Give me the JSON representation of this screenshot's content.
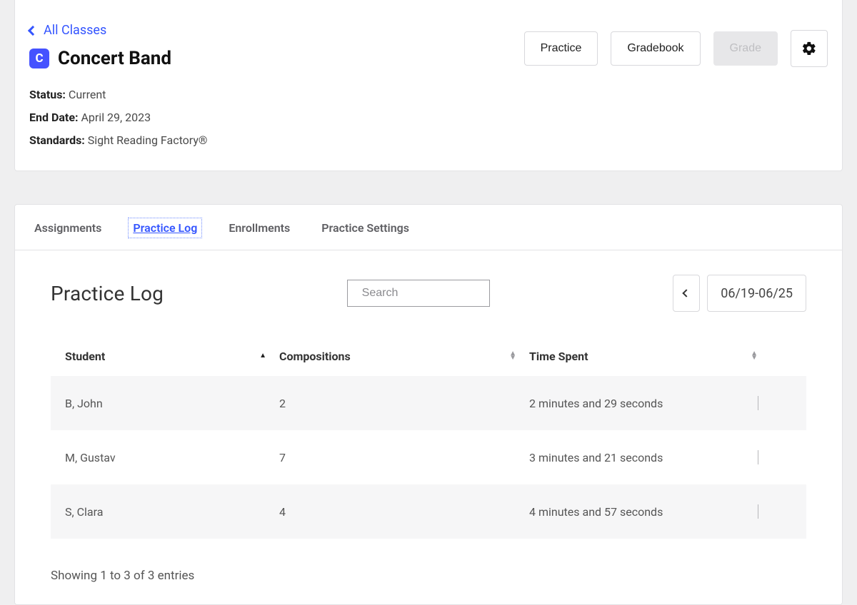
{
  "breadcrumb": {
    "back_label": "All Classes"
  },
  "class": {
    "badge_letter": "C",
    "title": "Concert Band",
    "status_label": "Status:",
    "status_value": "Current",
    "end_label": "End Date:",
    "end_value": "April 29, 2023",
    "standards_label": "Standards:",
    "standards_value": "Sight Reading Factory®"
  },
  "header_actions": {
    "practice": "Practice",
    "gradebook": "Gradebook",
    "grade": "Grade"
  },
  "tabs": {
    "assignments": "Assignments",
    "practice_log": "Practice Log",
    "enrollments": "Enrollments",
    "practice_settings": "Practice Settings"
  },
  "panel": {
    "title": "Practice Log",
    "search_placeholder": "Search",
    "date_range": "06/19-06/25",
    "columns": {
      "student": "Student",
      "compositions": "Compositions",
      "time": "Time Spent"
    },
    "rows": [
      {
        "student": "B, John",
        "comp": "2",
        "time": "2 minutes and 29 seconds"
      },
      {
        "student": "M, Gustav",
        "comp": "7",
        "time": "3 minutes and 21 seconds"
      },
      {
        "student": "S, Clara",
        "comp": "4",
        "time": "4 minutes and 57 seconds"
      }
    ],
    "footer": "Showing 1 to 3 of 3 entries"
  }
}
